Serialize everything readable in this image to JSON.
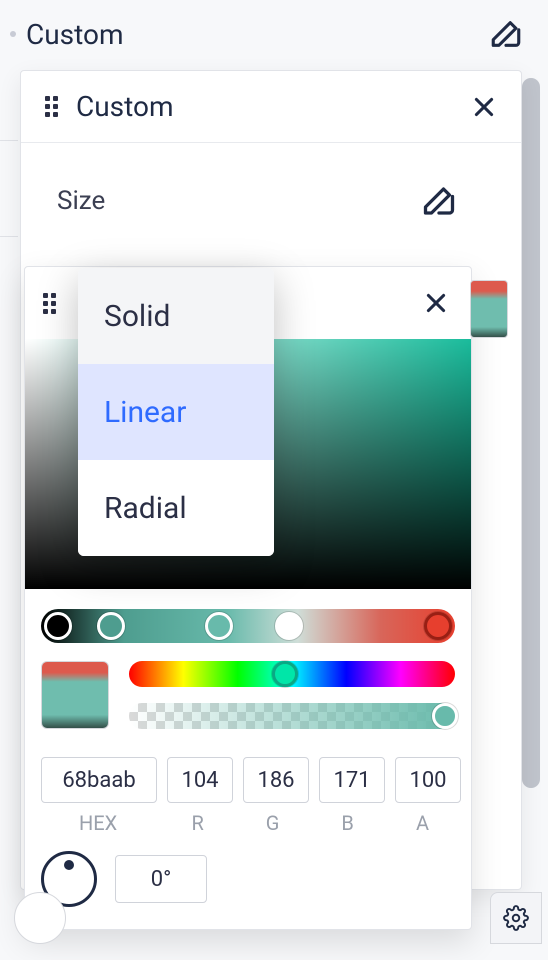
{
  "top": {
    "title": "Custom"
  },
  "panel1": {
    "title": "Custom",
    "size_label": "Size"
  },
  "menu": {
    "items": [
      "Solid",
      "Linear",
      "Radial"
    ],
    "selected_index": 1
  },
  "picker": {
    "base_hue_color": "#1abc9c",
    "gradient_stops": [
      {
        "pos": 0.04,
        "color": "#000000"
      },
      {
        "pos": 0.17,
        "color": "#4e9d8f"
      },
      {
        "pos": 0.43,
        "color": "#68baab"
      },
      {
        "pos": 0.6,
        "color": "#ffffff"
      },
      {
        "pos": 0.96,
        "color": "#e73f2e"
      }
    ],
    "hex": "68baab",
    "r": "104",
    "g": "186",
    "b": "171",
    "a": "100",
    "labels": {
      "hex": "HEX",
      "r": "R",
      "g": "G",
      "b": "B",
      "a": "A"
    },
    "angle": "0°"
  }
}
